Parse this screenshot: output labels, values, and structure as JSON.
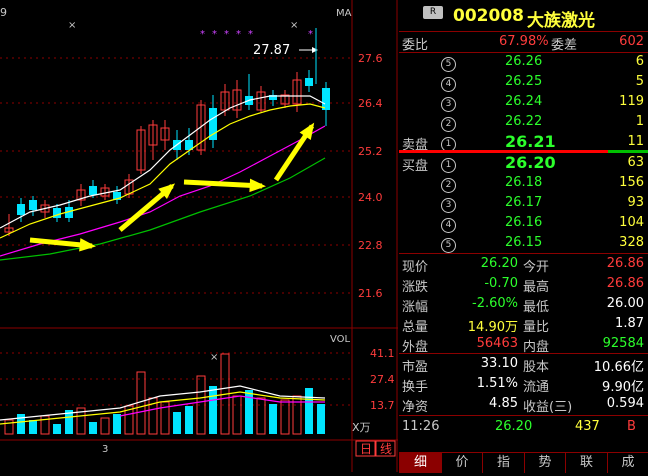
{
  "stock": {
    "badge": "R",
    "code": "002008",
    "name": "大族激光"
  },
  "chart": {
    "ma_label": "MA",
    "peak_price": "27.87",
    "cross_marks": [
      "×",
      "×",
      "×"
    ],
    "price_axis": [
      "27.6",
      "26.4",
      "25.2",
      "24.0",
      "22.8",
      "21.6"
    ],
    "vol_label": "VOL",
    "vol_axis": [
      "41.1",
      "27.4",
      "13.7"
    ],
    "vol_unit": "X万",
    "x_tick": "3",
    "corner_digit": "9",
    "tabs": [
      "日",
      "线"
    ],
    "colors": {
      "up": "#ff3c3c",
      "down": "#00e5ff",
      "ma5": "#ffffff",
      "ma10": "#ffff00",
      "ma20": "#ff00ff",
      "ma60": "#00c000",
      "arrow": "#ffff00",
      "grid": "#8b0000"
    }
  },
  "ratio": {
    "label1": "委比",
    "value1": "67.98%",
    "label2": "委差",
    "value2": "602"
  },
  "sell": [
    {
      "idx": "5",
      "price": "26.26",
      "vol": "6"
    },
    {
      "idx": "4",
      "price": "26.25",
      "vol": "5"
    },
    {
      "idx": "3",
      "price": "26.24",
      "vol": "119"
    },
    {
      "idx": "2",
      "price": "26.22",
      "vol": "1"
    },
    {
      "idx": "1",
      "price": "26.21",
      "vol": "11"
    }
  ],
  "sell_label": "卖盘",
  "buy_label": "买盘",
  "buy": [
    {
      "idx": "1",
      "price": "26.20",
      "vol": "63"
    },
    {
      "idx": "2",
      "price": "26.18",
      "vol": "156"
    },
    {
      "idx": "3",
      "price": "26.17",
      "vol": "93"
    },
    {
      "idx": "4",
      "price": "26.16",
      "vol": "104"
    },
    {
      "idx": "5",
      "price": "26.15",
      "vol": "328"
    }
  ],
  "quote": [
    {
      "l1": "现价",
      "v1": "26.20",
      "l2": "今开",
      "v2": "26.86"
    },
    {
      "l1": "涨跌",
      "v1": "-0.70",
      "l2": "最高",
      "v2": "26.86"
    },
    {
      "l1": "涨幅",
      "v1": "-2.60%",
      "l2": "最低",
      "v2": "26.00"
    },
    {
      "l1": "总量",
      "v1": "14.90万",
      "l2": "量比",
      "v2": "1.87"
    },
    {
      "l1": "外盘",
      "v1": "56463",
      "l2": "内盘",
      "v2": "92584"
    }
  ],
  "fund": [
    {
      "l1": "市盈",
      "v1": "33.10",
      "l2": "股本",
      "v2": "10.66亿"
    },
    {
      "l1": "换手",
      "v1": "1.51%",
      "l2": "流通",
      "v2": "9.90亿"
    },
    {
      "l1": "净资",
      "v1": "4.85",
      "l2": "收益(三)",
      "v2": "0.594"
    }
  ],
  "tick": {
    "time": "11:26",
    "price": "26.20",
    "vol": "437",
    "side": "B"
  },
  "bottom_tabs": [
    "细",
    "价",
    "指",
    "势",
    "联",
    "成"
  ]
}
